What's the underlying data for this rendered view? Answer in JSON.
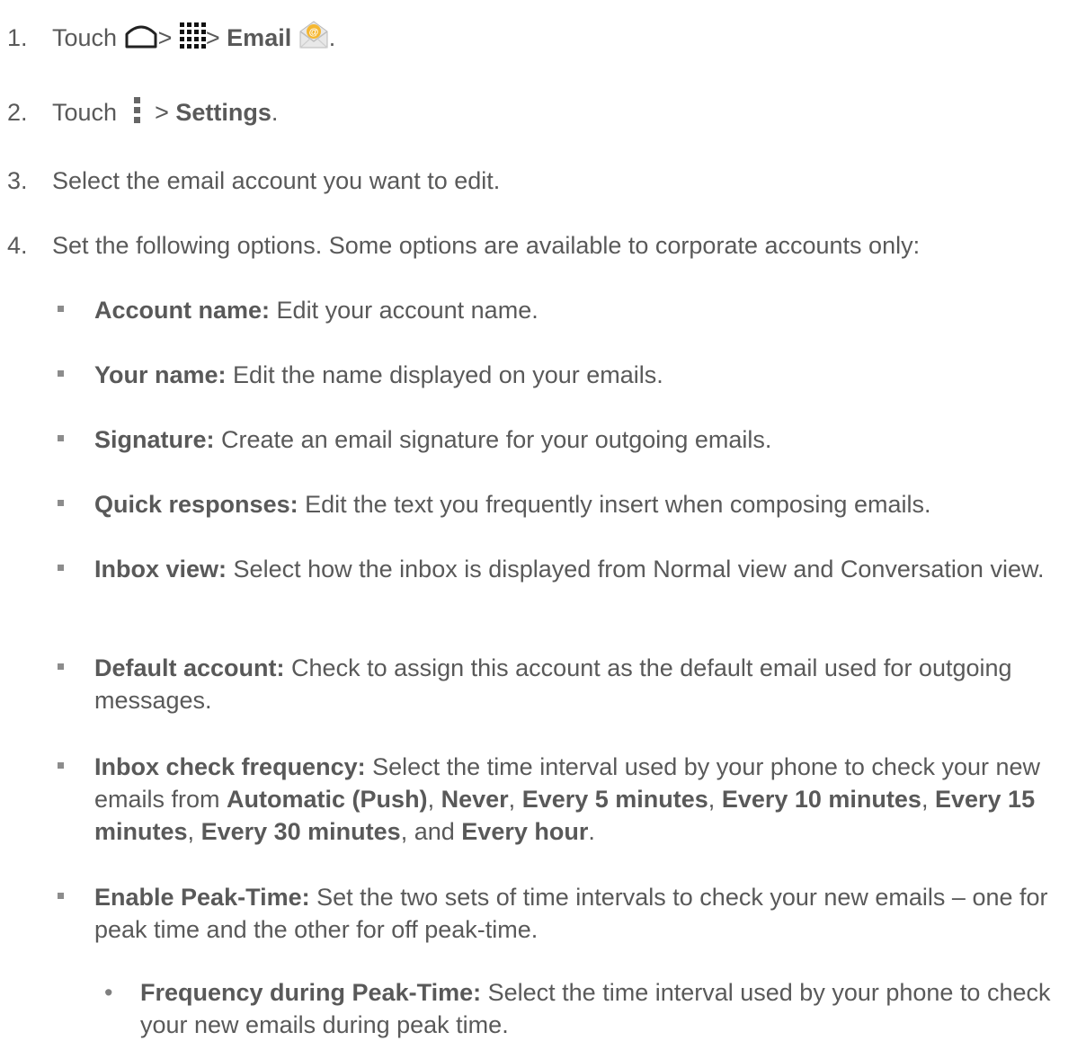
{
  "steps": [
    {
      "num": "1.",
      "prefix": "Touch",
      "sep1": ">",
      "sep2": ">",
      "bold": "Email",
      "suffix": ".",
      "icons": [
        "home-icon",
        "apps-icon",
        "email-app-icon"
      ]
    },
    {
      "num": "2.",
      "prefix": "Touch",
      "sep": ">",
      "bold": "Settings",
      "suffix": ".",
      "icons": [
        "menu-icon"
      ]
    },
    {
      "num": "3.",
      "text": "Select the email account you want to edit."
    },
    {
      "num": "4.",
      "text": "Set the following options. Some options are available to corporate accounts only:"
    }
  ],
  "options": [
    {
      "label": "Account name:",
      "desc": "Edit your account name."
    },
    {
      "label": "Your name:",
      "desc": "Edit the name displayed on your emails."
    },
    {
      "label": "Signature:",
      "desc": "Create an email signature for your outgoing emails."
    },
    {
      "label": "Quick responses:",
      "desc": "Edit the text you frequently insert when composing emails."
    },
    {
      "label": "Inbox view:",
      "desc": "Select how the inbox is displayed from Normal view and Conversation view."
    },
    {
      "label": "Default account:",
      "desc": "Check to assign this account as the default email used for outgoing messages."
    },
    {
      "label": "Inbox check frequency:",
      "desc_start": "Select the time interval used by your phone to check your new emails from",
      "choices": [
        "Automatic (Push)",
        "Never",
        "Every 5 minutes",
        "Every 10 minutes",
        "Every 15 minutes",
        "Every 30 minutes",
        "Every hour"
      ],
      "sep": ",",
      "and": "and",
      "end": "."
    },
    {
      "label": "Enable Peak-Time:",
      "desc": "Set the two sets of time intervals to check your new emails – one for peak time and the other for off peak-time."
    }
  ],
  "sub_options": [
    {
      "label": "Frequency during Peak-Time:",
      "desc": "Select the time interval used by your phone to check your new emails during peak time."
    }
  ],
  "colors": {
    "text": "#595959",
    "bullet": "#8c8c8c"
  }
}
